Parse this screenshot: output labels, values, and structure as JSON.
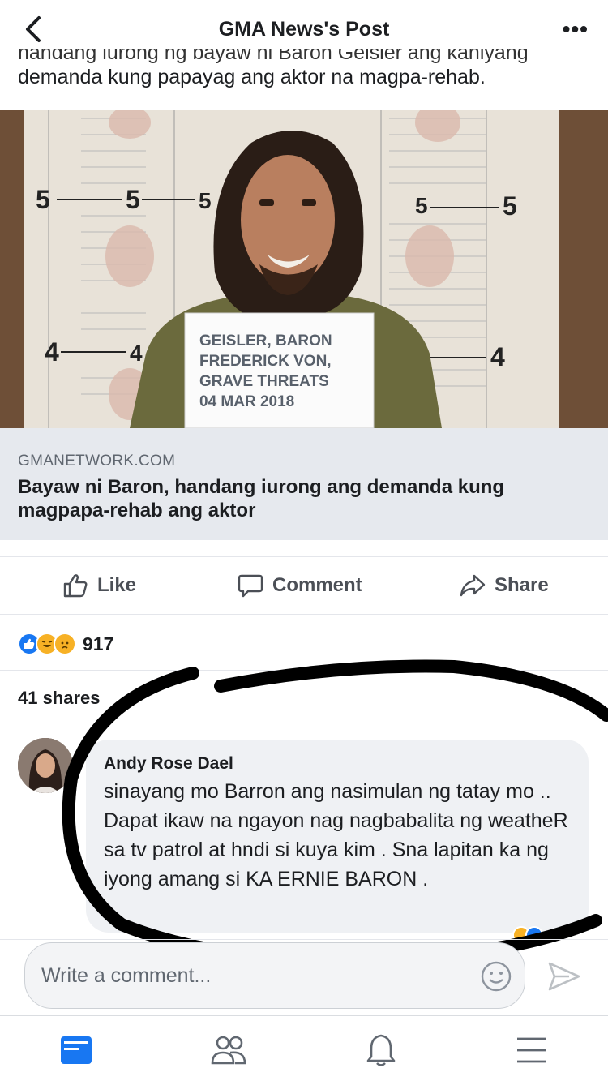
{
  "header": {
    "title": "GMA News's Post",
    "back_icon": "chevron-left-icon",
    "more_label": "•••"
  },
  "post": {
    "text_cut_line": "handang iurong ng bayaw ni Baron Geisler ang kaniyang",
    "text_line": "demanda kung papayag ang aktor na magpa-rehab.",
    "photo": {
      "placard_lines": [
        "GEISLER, BARON",
        "FREDERICK VON,",
        "GRAVE THREATS",
        "04 MAR 2018"
      ],
      "height_marks": {
        "top": "5",
        "bottom": "4"
      }
    },
    "link": {
      "domain": "GMANETWORK.COM",
      "title": "Bayaw ni Baron, handang iurong ang demanda kung magpapa-rehab ang aktor"
    }
  },
  "actions": {
    "like": "Like",
    "comment": "Comment",
    "share": "Share"
  },
  "engagement": {
    "reactions": [
      "like",
      "haha",
      "sad"
    ],
    "reaction_count": "917",
    "shares": "41 shares"
  },
  "comment": {
    "author": "Andy Rose Dael",
    "text": "sinayang mo Barron ang nasimulan ng tatay mo .. Dapat ikaw na ngayon nag nagbabalita ng weatheR sa tv patrol at hndi si kuya kim . Sna lapitan ka ng iyong amang si KA ERNIE BARON ."
  },
  "composer": {
    "placeholder": "Write a comment..."
  },
  "nav": [
    "news-feed-icon",
    "friends-icon",
    "notifications-icon",
    "menu-icon"
  ],
  "colors": {
    "facebook_blue": "#1877f2",
    "link_box_bg": "#e6e9ee",
    "bubble_bg": "#eff1f4",
    "ink": "#000000"
  }
}
